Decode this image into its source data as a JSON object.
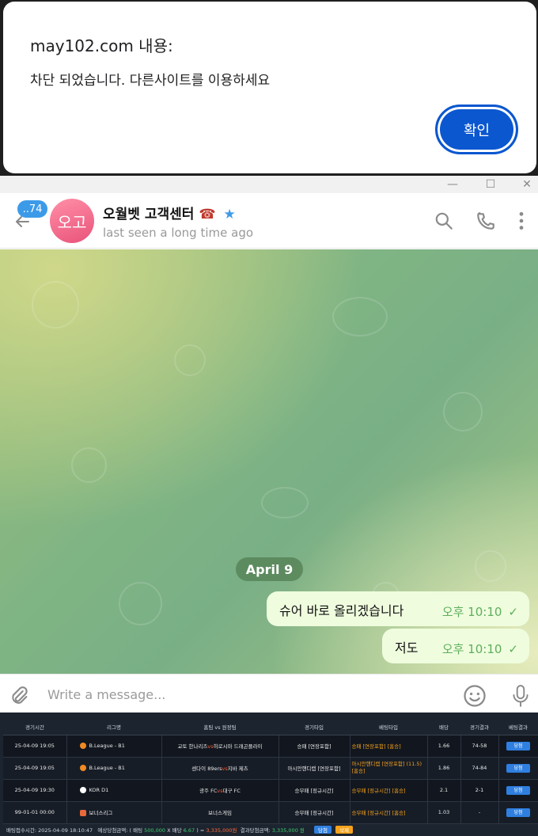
{
  "alert": {
    "title": "may102.com 내용:",
    "message": "차단 되었습니다. 다른사이트를 이용하세요",
    "ok_label": "확인",
    "accent": "#0b57d0"
  },
  "window": {
    "minimize": "—",
    "maximize": "☐",
    "close": "✕"
  },
  "chat": {
    "unread_count": "..74",
    "avatar_initials": "오고",
    "contact_name": "오월벳 고객센터",
    "contact_emoji": "☎",
    "verified_star": "★",
    "last_seen": "last seen a long time ago",
    "icons": [
      "back-arrow-icon",
      "search-icon",
      "phone-icon",
      "more-vertical-icon",
      "attach-icon",
      "emoji-icon",
      "microphone-icon"
    ],
    "date_label": "April 9",
    "messages": [
      {
        "text": "슈어 바로 올리겠습니다",
        "time": "오후 10:10",
        "status": "✓"
      },
      {
        "text": "저도",
        "time": "오후 10:10",
        "status": "✓"
      }
    ],
    "input_placeholder": "Write a message...",
    "bubble_color": "#effdde",
    "time_color": "#5fae5c"
  },
  "bet": {
    "headers": [
      "경기시간",
      "리그명",
      "홈팀 vs 원정팀",
      "경기타입",
      "베팅타입",
      "배당",
      "경기결과",
      "베팅결과"
    ],
    "rows": [
      {
        "time": "25-04-09 19:05",
        "league": "B.League - B1",
        "home": "교토 한나리즈",
        "vs": "vs",
        "away": "히로시마 드래곤플라이",
        "type": "승패 [연장포함]",
        "bet_type": "승패 [연장포함] [홈승]",
        "odds": "1.66",
        "result": "74-58",
        "outcome": "당첨"
      },
      {
        "time": "25-04-09 19:05",
        "league": "B.League - B1",
        "home": "센다이 89ers",
        "vs": "vs",
        "away": "지바 제츠",
        "type": "아시안핸디캡 [연장포함]",
        "bet_type": "아시안핸디캡 [연장포함] (11.5) [홈승]",
        "odds": "1.86",
        "result": "74-84",
        "outcome": "당첨"
      },
      {
        "time": "25-04-09 19:30",
        "league": "KOR D1",
        "home": "광주 FC",
        "vs": "vs",
        "away": "대구 FC",
        "type": "승무패 [정규시간]",
        "bet_type": "승무패 [정규시간] [홈승]",
        "odds": "2.1",
        "result": "2-1",
        "outcome": "당첨"
      },
      {
        "time": "99-01-01 00:00",
        "league": "보너스리그",
        "home": "보너스게임",
        "vs": "",
        "away": "",
        "type": "승무패 [정규시간]",
        "bet_type": "승무패 [정규시간] [홈승]",
        "odds": "1.03",
        "result": "-",
        "outcome": "당첨"
      }
    ],
    "footer": {
      "bet_time_label": "배팅접수시간: 2025-04-09 18:10:47",
      "expected_label": "예상당첨금액: ( 배팅",
      "stake": "500,000",
      "times_label": "X 배당",
      "total_odds": "6.67",
      "equals_label": ") =",
      "expected_amount": "3,335,000원",
      "result_label": "결과당첨금액:",
      "result_amount": "3,335,000 원",
      "status_btn": "당첨",
      "delete_btn": "삭제"
    }
  }
}
